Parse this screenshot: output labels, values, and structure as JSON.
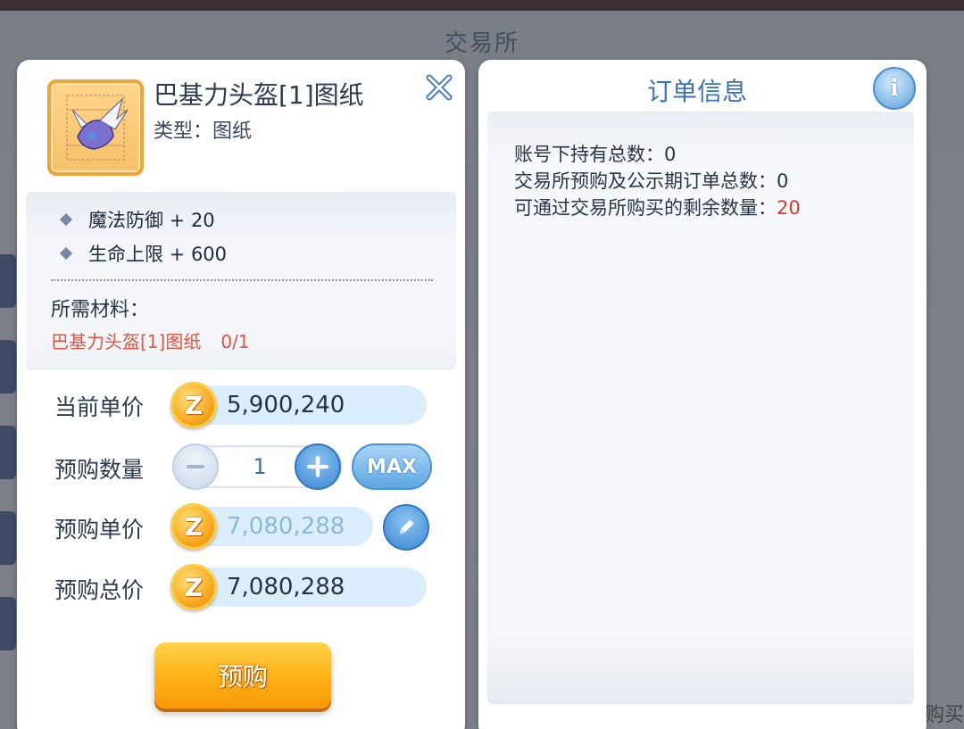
{
  "background": {
    "title": "交易所",
    "partial_text": "购买"
  },
  "item": {
    "name": "巴基力头盔[1]图纸",
    "type_label": "类型：图纸",
    "attributes": [
      {
        "text": "魔法防御 + 20"
      },
      {
        "text": "生命上限 + 600"
      }
    ],
    "materials_label": "所需材料：",
    "materials": [
      {
        "name": "巴基力头盔[1]图纸",
        "qty": "0/1"
      }
    ]
  },
  "purchase": {
    "current_price_label": "当前单价",
    "current_price": "5,900,240",
    "quantity_label": "预购数量",
    "quantity": "1",
    "max_label": "MAX",
    "unit_price_label": "预购单价",
    "unit_price": "7,080,288",
    "total_price_label": "预购总价",
    "total_price": "7,080,288",
    "coin_symbol": "Z",
    "buy_button": "预购"
  },
  "order": {
    "title": "订单信息",
    "info_symbol": "i",
    "lines": [
      {
        "label": "账号下持有总数：",
        "value": "0"
      },
      {
        "label": "交易所预购及公示期订单总数：",
        "value": "0"
      },
      {
        "label": "可通过交易所购买的剩余数量：",
        "value": "20"
      }
    ]
  },
  "colors": {
    "accent_blue": "#3a72b8",
    "warning_red": "#e5533d",
    "button_orange": "#ffb016"
  }
}
